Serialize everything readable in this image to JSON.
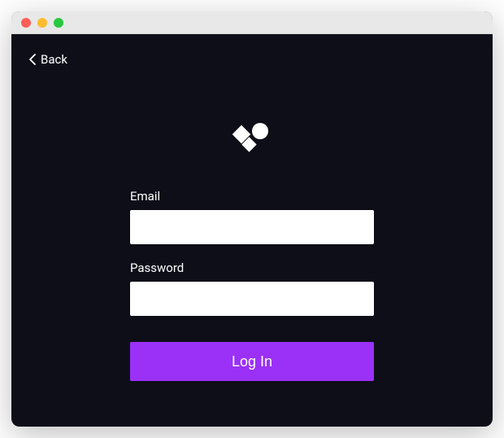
{
  "nav": {
    "back_label": "Back"
  },
  "form": {
    "email_label": "Email",
    "email_value": "",
    "password_label": "Password",
    "password_value": "",
    "login_label": "Log In"
  },
  "colors": {
    "accent": "#9b30f7",
    "background": "#0e0e19"
  }
}
